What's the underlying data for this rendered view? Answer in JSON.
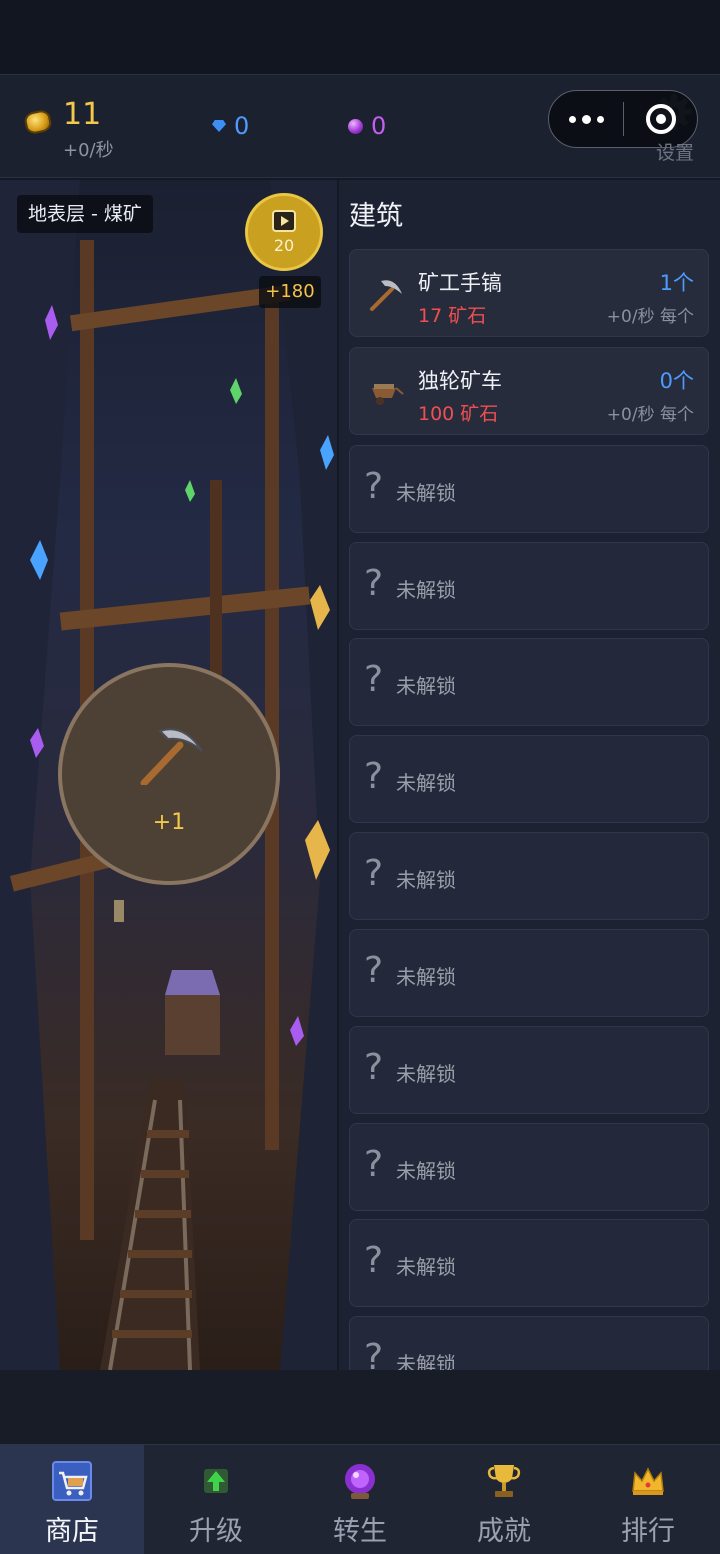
{
  "resources": {
    "ore": {
      "value": "11",
      "rate": "+0/秒"
    },
    "gems": {
      "value": "0",
      "color": "#3d8ef5"
    },
    "essence": {
      "value": "0",
      "color": "#c55df0"
    }
  },
  "settings": {
    "label": "设置"
  },
  "scene": {
    "layer_label": "地表层 - 煤矿",
    "video": {
      "cost": "20",
      "reward": "+180"
    },
    "mine_button": {
      "gain": "+1"
    }
  },
  "panel": {
    "title": "建筑",
    "buildings": [
      {
        "name": "矿工手镐",
        "cost": "17 矿石",
        "count": "1个",
        "rate": "+0/秒 每个",
        "icon": "pickaxe-icon"
      },
      {
        "name": "独轮矿车",
        "cost": "100 矿石",
        "count": "0个",
        "rate": "+0/秒 每个",
        "icon": "wheelbarrow-icon"
      }
    ],
    "locked_label": "未解锁",
    "locked_mark": "?"
  },
  "nav": [
    {
      "label": "商店",
      "icon": "shop-cart-icon",
      "active": true
    },
    {
      "label": "升级",
      "icon": "upgrade-arrow-icon",
      "active": false
    },
    {
      "label": "转生",
      "icon": "crystal-ball-icon",
      "active": false
    },
    {
      "label": "成就",
      "icon": "trophy-icon",
      "active": false
    },
    {
      "label": "排行",
      "icon": "crown-icon",
      "active": false
    }
  ],
  "colors": {
    "accent_gold": "#f4c84a",
    "count_blue": "#4e9bff",
    "cost_red": "#f04f50"
  }
}
